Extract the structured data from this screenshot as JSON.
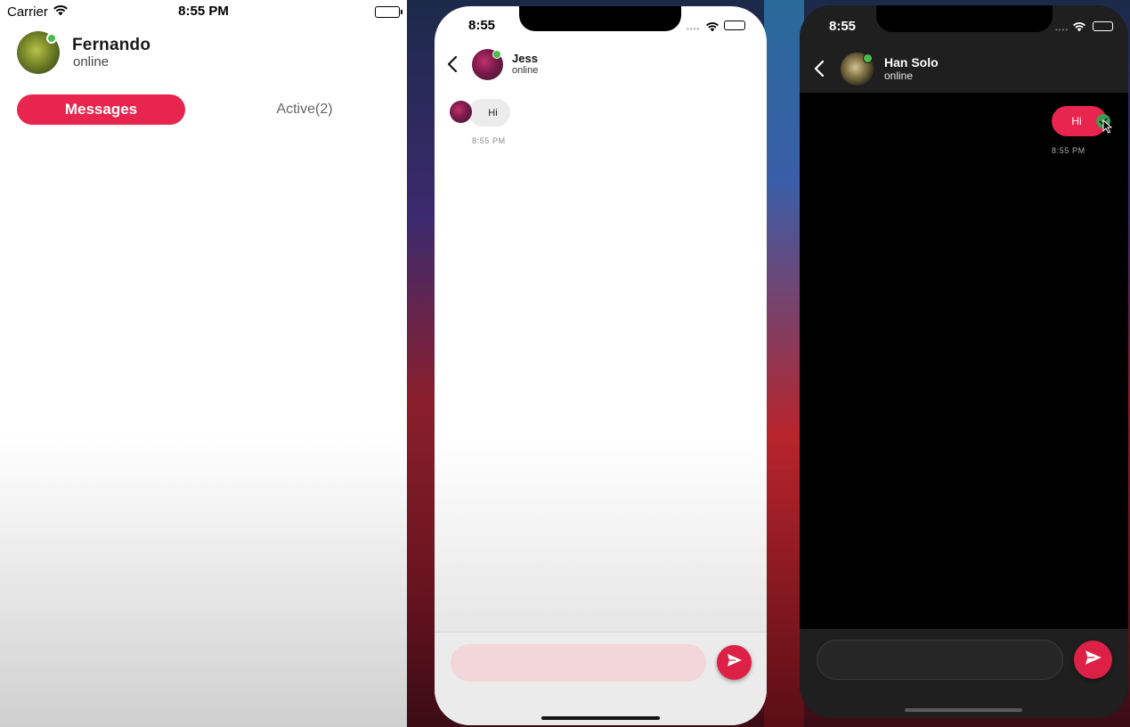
{
  "phone_list": {
    "status": {
      "carrier": "Carrier",
      "time": "8:55 PM"
    },
    "user": {
      "name": "Fernando",
      "status": "online"
    },
    "tabs": {
      "messages": "Messages",
      "active": "Active(2)"
    }
  },
  "phone_chat_light": {
    "status": {
      "time": "8:55"
    },
    "contact": {
      "name": "Jess",
      "status": "online"
    },
    "messages": [
      {
        "text": "Hi",
        "time": "8:55 PM",
        "from": "contact"
      }
    ],
    "input": {
      "placeholder": ""
    }
  },
  "phone_chat_dark": {
    "status": {
      "time": "8:55"
    },
    "contact": {
      "name": "Han Solo",
      "status": "online"
    },
    "messages": [
      {
        "text": "Hi",
        "time": "8:55 PM",
        "from": "me"
      }
    ],
    "input": {
      "placeholder": ""
    }
  },
  "colors": {
    "accent": "#e8254f",
    "online": "#4cbb50",
    "dark_bg": "#000000",
    "dark_bar": "#1f1f1f"
  },
  "icons": [
    "wifi-icon",
    "battery-icon",
    "back-chevron-icon",
    "send-icon",
    "checkmark-icon",
    "cursor-icon"
  ]
}
